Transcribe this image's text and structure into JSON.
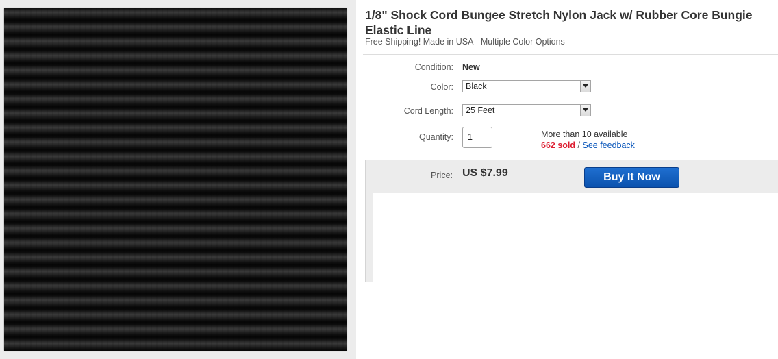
{
  "listing": {
    "title": "1/8\" Shock Cord Bungee Stretch Nylon Jack w/ Rubber Core Bungie Elastic Line",
    "subtitle": "Free Shipping! Made in USA - Multiple Color Options"
  },
  "specifics": {
    "condition_label": "Condition:",
    "condition_value": "New",
    "color_label": "Color:",
    "color_value": "Black",
    "length_label": "Cord Length:",
    "length_value": "25 Feet",
    "quantity_label": "Quantity:",
    "quantity_value": "1",
    "availability": "More than 10 available",
    "sold": "662 sold",
    "separator": "/",
    "feedback": "See feedback"
  },
  "purchase": {
    "price_label": "Price:",
    "price_value": "US $7.99",
    "buy_label": "Buy It Now",
    "button_color": "#0b52ae"
  },
  "icons": {
    "select_arrow": "chevron-down-icon"
  }
}
